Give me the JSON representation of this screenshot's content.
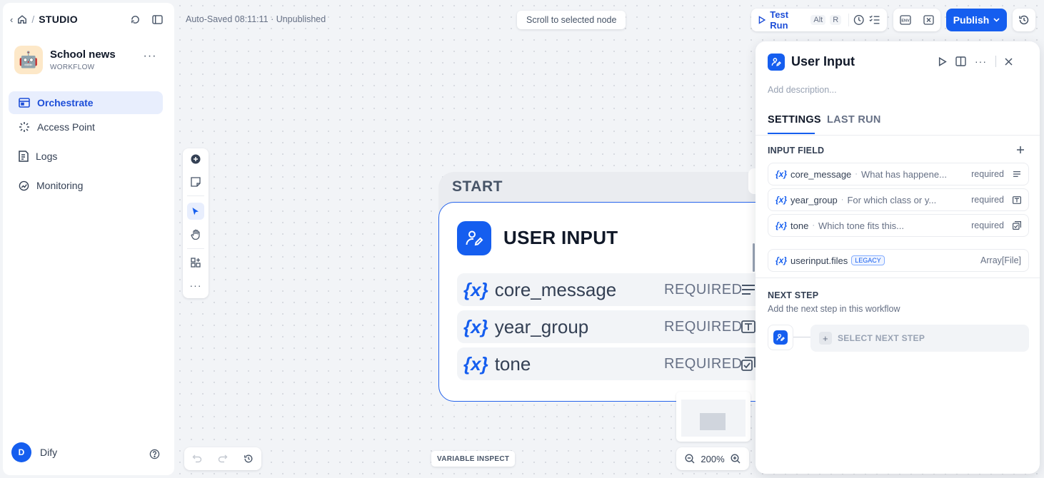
{
  "sidebar": {
    "breadcrumb_sep": "/",
    "breadcrumb": "STUDIO",
    "app": {
      "name": "School news",
      "type": "WORKFLOW",
      "emoji": "🤖"
    },
    "nav": [
      {
        "label": "Orchestrate",
        "icon": "orchestrate-icon",
        "active": true
      },
      {
        "label": "Access Point",
        "icon": "access-point-icon",
        "active": false
      },
      {
        "label": "Logs",
        "icon": "logs-icon",
        "active": false
      },
      {
        "label": "Monitoring",
        "icon": "monitoring-icon",
        "active": false
      }
    ],
    "user": {
      "initial": "D",
      "name": "Dify"
    }
  },
  "header": {
    "status": "Auto-Saved 08:11:11 · Unpublished",
    "scroll_to_node": "Scroll to selected node",
    "test_run": {
      "label": "Test Run",
      "shortcut_1": "Alt",
      "shortcut_2": "R"
    },
    "publish": "Publish"
  },
  "canvas": {
    "start_label": "START",
    "node_title": "USER INPUT",
    "variables": [
      {
        "symbol": "{x}",
        "name": "core_message",
        "required": "REQUIRED",
        "icon": "paragraph-icon"
      },
      {
        "symbol": "{x}",
        "name": "year_group",
        "required": "REQUIRED",
        "icon": "text-input-icon"
      },
      {
        "symbol": "{x}",
        "name": "tone",
        "required": "REQUIRED",
        "icon": "select-icon"
      }
    ],
    "zoom": "200%",
    "variable_inspect": "VARIABLE INSPECT"
  },
  "panel": {
    "title": "User Input",
    "description_placeholder": "Add description...",
    "tabs": [
      {
        "label": "SETTINGS",
        "active": true
      },
      {
        "label": "LAST RUN",
        "active": false
      }
    ],
    "input_field_title": "INPUT FIELD",
    "fields": [
      {
        "symbol": "{x}",
        "name": "core_message",
        "desc": "What has happene...",
        "required": "required",
        "icon": "paragraph-icon"
      },
      {
        "symbol": "{x}",
        "name": "year_group",
        "desc": "For which class or y...",
        "required": "required",
        "icon": "text-input-icon"
      },
      {
        "symbol": "{x}",
        "name": "tone",
        "desc": "Which tone fits this...",
        "required": "required",
        "icon": "select-icon"
      }
    ],
    "files_field": {
      "symbol": "{x}",
      "name": "userinput.files",
      "badge": "LEGACY",
      "type": "Array[File]"
    },
    "next_step_title": "NEXT STEP",
    "next_step_desc": "Add the next step in this workflow",
    "select_next_step": "SELECT NEXT STEP"
  },
  "colors": {
    "accent": "#155eef",
    "active_nav_bg": "#e8eefd",
    "canvas_bg": "#f2f4f7"
  }
}
